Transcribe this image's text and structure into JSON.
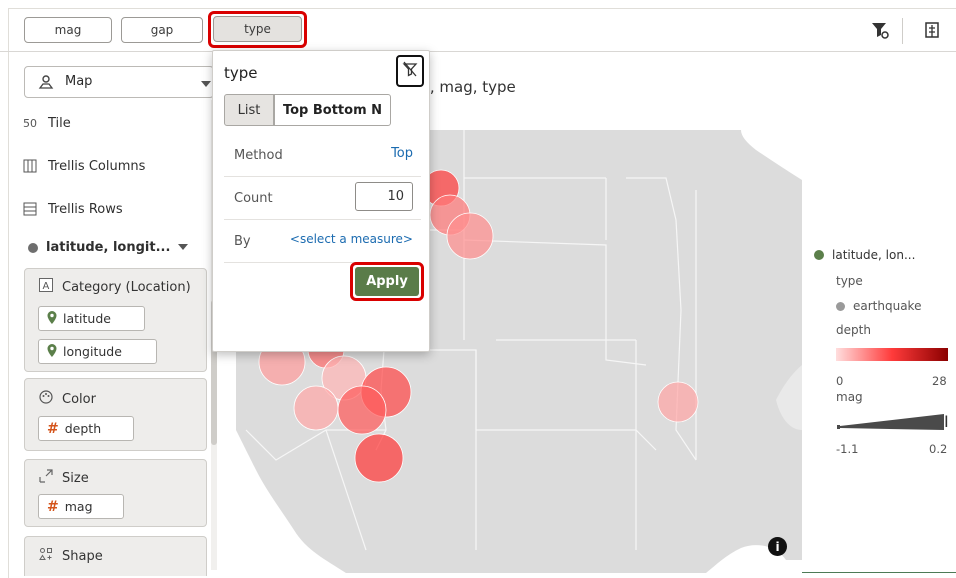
{
  "filter_bar": {
    "chips": [
      {
        "label": "mag"
      },
      {
        "label": "gap"
      },
      {
        "label": "type"
      }
    ],
    "icons": [
      "filter-settings-icon",
      "collapse-icon"
    ]
  },
  "left_panel": {
    "viz_type": "Map",
    "rows": [
      {
        "label": "Tile",
        "icon": "tile-icon"
      },
      {
        "label": "Trellis Columns",
        "icon": "trellis-columns-icon"
      },
      {
        "label": "Trellis Rows",
        "icon": "trellis-rows-icon"
      }
    ],
    "layer_title": "latitude, longit...",
    "groups": {
      "category": {
        "title": "Category (Location)",
        "items": [
          "latitude",
          "longitude"
        ]
      },
      "color": {
        "title": "Color",
        "items": [
          "depth"
        ]
      },
      "size": {
        "title": "Size",
        "items": [
          "mag"
        ]
      },
      "shape": {
        "title": "Shape"
      }
    }
  },
  "canvas": {
    "title_visible": "), mag, type"
  },
  "legend": {
    "layer": "latitude, lon...",
    "type_label": "type",
    "type_item": "earthquake",
    "depth_label": "depth",
    "depth_min": "0",
    "depth_max": "28",
    "mag_label": "mag",
    "mag_min": "-1.1",
    "mag_max": "0.2",
    "colors": {
      "layer_dot": "#5b7f4a",
      "type_dot": "#9a9a9a"
    }
  },
  "popup": {
    "title": "type",
    "tabs": [
      "List",
      "Top Bottom N"
    ],
    "method_label": "Method",
    "method_value": "Top",
    "count_label": "Count",
    "count_value": "10",
    "by_label": "By",
    "by_value": "<select a measure>",
    "apply_label": "Apply"
  },
  "colors": {
    "highlight": "#d90000",
    "apply_bg": "#5a7c49",
    "link": "#1b6bb0"
  }
}
